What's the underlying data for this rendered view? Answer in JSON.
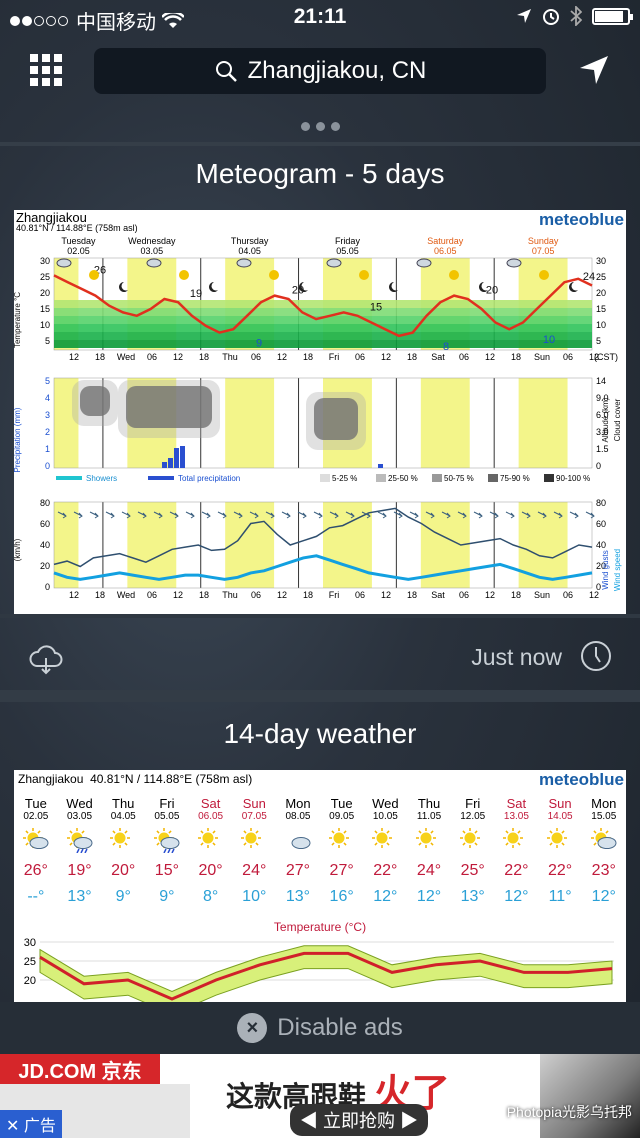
{
  "status_bar": {
    "carrier": "中国移动",
    "time": "21:11"
  },
  "search": {
    "location": "Zhangjiakou, CN"
  },
  "meteogram": {
    "title": "Meteogram - 5 days",
    "location": "Zhangjiakou",
    "coords": "40.81°N / 114.88°E (758m asl)",
    "brand": "meteoblue",
    "days": [
      {
        "name": "Tuesday",
        "date": "02.05",
        "weekend": false
      },
      {
        "name": "Wednesday",
        "date": "03.05",
        "weekend": false
      },
      {
        "name": "Thursday",
        "date": "04.05",
        "weekend": false
      },
      {
        "name": "Friday",
        "date": "05.05",
        "weekend": false
      },
      {
        "name": "Saturday",
        "date": "06.05",
        "weekend": true
      },
      {
        "name": "Sunday",
        "date": "07.05",
        "weekend": true
      }
    ],
    "axis_labels": {
      "temperature": "Temperature °C",
      "precipitation": "Precipitation (mm)",
      "altitude": "Altitude (km)",
      "cloud": "Cloud cover",
      "wind": "(km/h)",
      "gusts": "Wind gusts",
      "speed": "Wind speed",
      "tz": "(CST)"
    },
    "x_ticks": [
      "12",
      "18",
      "Wed",
      "06",
      "12",
      "18",
      "Thu",
      "06",
      "12",
      "18",
      "Fri",
      "06",
      "12",
      "18",
      "Sat",
      "06",
      "12",
      "18",
      "Sun",
      "06",
      "12"
    ],
    "temp_labels": [
      "26",
      "19",
      "9",
      "20",
      "15",
      "8",
      "20",
      "10",
      "24"
    ],
    "legend": {
      "showers": "Showers",
      "total": "Total precipitation",
      "c1": "5-25 %",
      "c2": "25-50 %",
      "c3": "50-75 %",
      "c4": "75-90 %",
      "c5": "90-100 %"
    },
    "temp_y": [
      "30",
      "25",
      "20",
      "15",
      "10",
      "5"
    ],
    "precip_y": [
      "5",
      "4",
      "3",
      "2",
      "1",
      "0"
    ],
    "alt_y": [
      "14",
      "9.0",
      "6.0",
      "3.0",
      "1.5",
      "0"
    ],
    "wind_y": [
      "80",
      "60",
      "40",
      "20",
      "0"
    ]
  },
  "meta": {
    "updated": "Just now"
  },
  "fourteen": {
    "title": "14-day weather",
    "location": "Zhangjiakou",
    "coords": "40.81°N / 114.88°E (758m asl)",
    "brand": "meteoblue",
    "temp_title": "Temperature (°C)",
    "chart_y": [
      "30",
      "25",
      "20"
    ],
    "days": [
      {
        "day": "Tue",
        "date": "02.05",
        "hi": "26°",
        "lo": "--°",
        "red": false,
        "icon": "sun-cloud-icon"
      },
      {
        "day": "Wed",
        "date": "03.05",
        "hi": "19°",
        "lo": "13°",
        "red": false,
        "icon": "rain-cloud-icon"
      },
      {
        "day": "Thu",
        "date": "04.05",
        "hi": "20°",
        "lo": "9°",
        "red": false,
        "icon": "sun-icon"
      },
      {
        "day": "Fri",
        "date": "05.05",
        "hi": "15°",
        "lo": "9°",
        "red": false,
        "icon": "sun-rain-icon"
      },
      {
        "day": "Sat",
        "date": "06.05",
        "hi": "20°",
        "lo": "8°",
        "red": true,
        "icon": "sun-icon"
      },
      {
        "day": "Sun",
        "date": "07.05",
        "hi": "24°",
        "lo": "10°",
        "red": true,
        "icon": "sun-icon"
      },
      {
        "day": "Mon",
        "date": "08.05",
        "hi": "27°",
        "lo": "13°",
        "red": false,
        "icon": "cloud-icon"
      },
      {
        "day": "Tue",
        "date": "09.05",
        "hi": "27°",
        "lo": "16°",
        "red": false,
        "icon": "sun-icon"
      },
      {
        "day": "Wed",
        "date": "10.05",
        "hi": "22°",
        "lo": "12°",
        "red": false,
        "icon": "sun-icon"
      },
      {
        "day": "Thu",
        "date": "11.05",
        "hi": "24°",
        "lo": "12°",
        "red": false,
        "icon": "sun-icon"
      },
      {
        "day": "Fri",
        "date": "12.05",
        "hi": "25°",
        "lo": "13°",
        "red": false,
        "icon": "sun-icon"
      },
      {
        "day": "Sat",
        "date": "13.05",
        "hi": "22°",
        "lo": "12°",
        "red": true,
        "icon": "sun-icon"
      },
      {
        "day": "Sun",
        "date": "14.05",
        "hi": "22°",
        "lo": "11°",
        "red": true,
        "icon": "sun-icon"
      },
      {
        "day": "Mon",
        "date": "15.05",
        "hi": "23°",
        "lo": "12°",
        "red": false,
        "icon": "sun-cloud-icon"
      }
    ]
  },
  "ads": {
    "disable": "Disable ads",
    "jd": "JD.COM 京东",
    "label": "广告",
    "headline_a": "这款高跟鞋",
    "headline_b": "火了",
    "cta": "立即抢购",
    "watermark": "Photopia光影乌托邦"
  },
  "colors": {
    "accent": "#1a5ea6",
    "red": "#c01a3b",
    "blue": "#2aa0d6",
    "yellow": "#f3f58a"
  }
}
